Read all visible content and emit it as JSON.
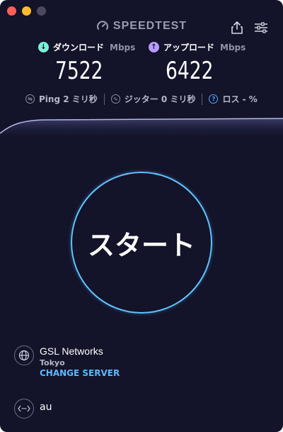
{
  "window": {
    "title": "SPEEDTEST",
    "colors": {
      "background": "#13132a",
      "accent": "#61c3ff",
      "download": "#7df0d8",
      "upload": "#b79bff"
    }
  },
  "toolbar": {
    "share_icon": "share-icon",
    "settings_icon": "settings-sliders-icon"
  },
  "download": {
    "label": "ダウンロード",
    "unit": "Mbps",
    "value": "7522",
    "icon": "arrow-down-circle-icon"
  },
  "upload": {
    "label": "アップロード",
    "unit": "Mbps",
    "value": "6422",
    "icon": "arrow-up-circle-icon"
  },
  "stats": {
    "ping": "Ping 2 ミリ秒",
    "jitter": "ジッター 0 ミリ秒",
    "loss": "ロス - %"
  },
  "start_button": {
    "label": "スタート"
  },
  "server": {
    "name": "GSL Networks",
    "location": "Tokyo",
    "change_label": "CHANGE SERVER",
    "icon": "globe-icon"
  },
  "provider": {
    "name": "au",
    "icon": "connection-icon"
  }
}
